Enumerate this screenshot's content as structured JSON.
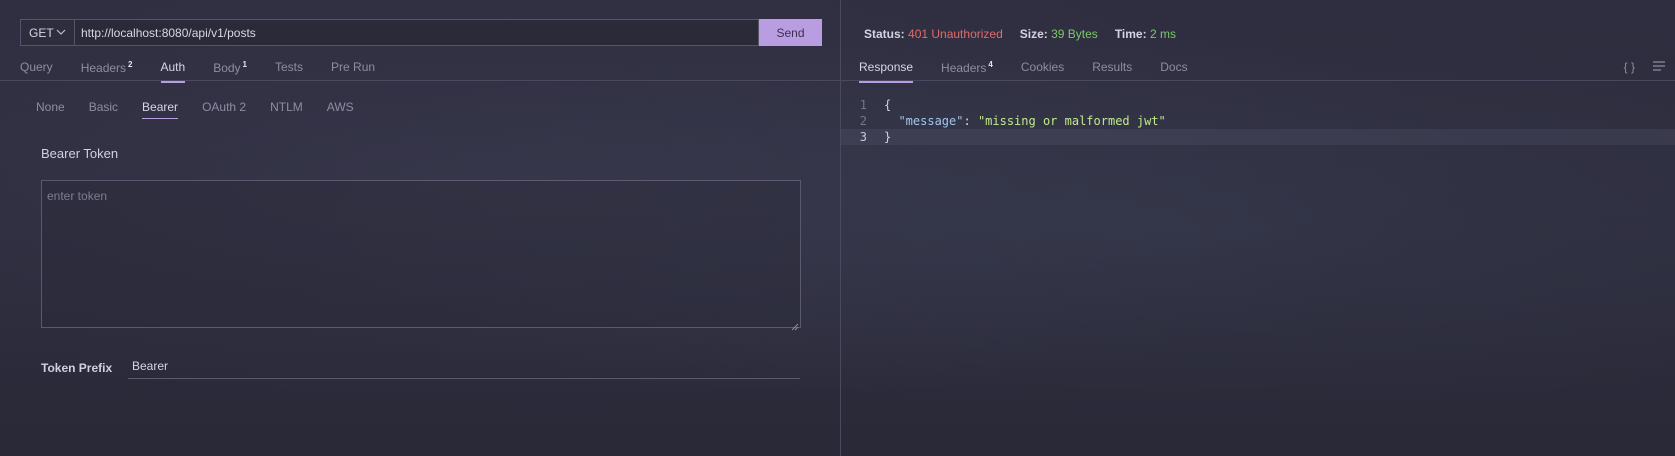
{
  "request": {
    "method": "GET",
    "url": "http://localhost:8080/api/v1/posts",
    "send_label": "Send"
  },
  "request_tabs": [
    {
      "label": "Query",
      "badge": ""
    },
    {
      "label": "Headers",
      "badge": "2"
    },
    {
      "label": "Auth",
      "badge": "",
      "active": true
    },
    {
      "label": "Body",
      "badge": "1"
    },
    {
      "label": "Tests",
      "badge": ""
    },
    {
      "label": "Pre Run",
      "badge": ""
    }
  ],
  "auth_tabs": [
    {
      "label": "None"
    },
    {
      "label": "Basic"
    },
    {
      "label": "Bearer",
      "active": true
    },
    {
      "label": "OAuth 2"
    },
    {
      "label": "NTLM"
    },
    {
      "label": "AWS"
    }
  ],
  "bearer": {
    "title": "Bearer Token",
    "token_placeholder": "enter token",
    "token_value": "",
    "prefix_label": "Token Prefix",
    "prefix_value": "Bearer"
  },
  "response_status": {
    "status_label": "Status:",
    "status_value": "401 Unauthorized",
    "size_label": "Size:",
    "size_value": "39 Bytes",
    "time_label": "Time:",
    "time_value": "2 ms"
  },
  "response_tabs": [
    {
      "label": "Response",
      "badge": "",
      "active": true
    },
    {
      "label": "Headers",
      "badge": "4"
    },
    {
      "label": "Cookies",
      "badge": ""
    },
    {
      "label": "Results",
      "badge": ""
    },
    {
      "label": "Docs",
      "badge": ""
    }
  ],
  "response_body": {
    "line_numbers": [
      "1",
      "2",
      "3"
    ],
    "key": "\"message\"",
    "colon": ": ",
    "value": "\"missing or malformed jwt\"",
    "open_brace": "{",
    "close_brace": "}"
  },
  "icons": {
    "method_dropdown": "chevron-down-icon",
    "format_json": "braces-icon",
    "menu": "hamburger-menu-icon",
    "resize": "resize-handle-icon"
  },
  "colors": {
    "accent": "#b89de0",
    "status_error": "#e26a6a",
    "status_ok": "#7bc86a"
  }
}
